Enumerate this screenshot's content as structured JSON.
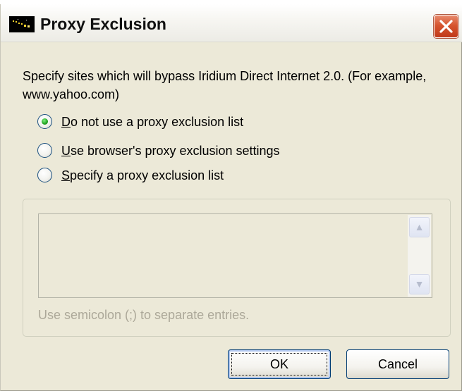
{
  "window": {
    "title": "Proxy Exclusion",
    "icon": "app-logo-icon",
    "close_icon": "close-icon"
  },
  "description": "Specify sites which will bypass Iridium Direct Internet 2.0.  (For example, www.yahoo.com)",
  "options": [
    {
      "mnemonic": "D",
      "rest": "o not use a proxy exclusion list",
      "selected": true
    },
    {
      "mnemonic": "U",
      "rest": "se browser's proxy exclusion settings",
      "selected": false
    },
    {
      "mnemonic": "S",
      "rest": "pecify a proxy exclusion list",
      "selected": false
    }
  ],
  "exclusion_list": {
    "value": "",
    "enabled": false,
    "hint": "Use semicolon (;) to separate entries."
  },
  "buttons": {
    "ok": "OK",
    "cancel": "Cancel"
  },
  "colors": {
    "window_bg": "#ece9d8",
    "close_red": "#d6552f",
    "radio_green": "#21a121",
    "disabled_text": "#aca899",
    "button_border": "#003c74"
  }
}
